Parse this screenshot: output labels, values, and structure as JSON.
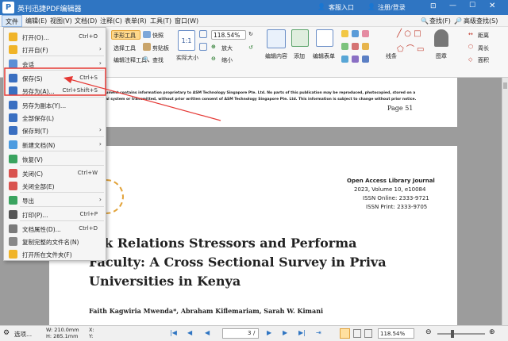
{
  "app": {
    "title": "英刊迅捷PDF编辑器",
    "logo": "P"
  },
  "titlebar": {
    "guest": "客服入口",
    "login": "注册/登录"
  },
  "menubar": {
    "items": [
      "文件",
      "编辑(E)",
      "视图(V)",
      "文档(D)",
      "注释(C)",
      "表单(R)",
      "工具(T)",
      "窗口(W)"
    ],
    "find": "查找(F)",
    "adv_find": "高级查找(S)"
  },
  "ribbon": {
    "hand_tool": "手形工具",
    "select_tool": "选择工具",
    "edit_annot_tool": "编辑注释工具",
    "snapshot": "快照",
    "clipboard": "剪贴板",
    "find": "查找",
    "actual_size": "实际大小",
    "zoom": "118.54%",
    "zoom_in": "放大",
    "zoom_out": "缩小",
    "edit_content": "编辑内容",
    "add": "添加",
    "edit_form": "编辑表单",
    "lines": "线条",
    "stamp": "图章",
    "distance": "距离",
    "perimeter": "周长",
    "area": "面积"
  },
  "document": {
    "page1_notice_1": "...ument contains information proprietary to ASM Technology Singapore Pte. Ltd. No parts of this publication may be reproduced, photocopied, stored on a",
    "page1_notice_2": "...al system or transmitted, without prior written consent of ASM Technology Singapore Pte. Ltd. This information is subject to change without prior notice.",
    "page1_num": "Page 51",
    "journal": "Open Access Library Journal",
    "volume": "2023, Volume 10, e10084",
    "issn_online": "ISSN Online: 2333-9721",
    "issn_print": "ISSN Print: 2333-9705",
    "title_1": "ork Relations Stressors and Performa",
    "title_2": "Faculty: A Cross Sectional Survey in Priva",
    "title_3": "Universities in Kenya",
    "authors": "Faith Kagwiria Mwenda*, Abraham Kiflemariam, Sarah W. Kimani"
  },
  "statusbar": {
    "options": "选项...",
    "width": "W: 210.0mm",
    "height": "H: 285.1mm",
    "x": "X:",
    "y": "Y:",
    "page": "3",
    "page_total": "/",
    "zoom": "118.54%"
  },
  "file_menu": {
    "items": [
      {
        "label": "打开(O)...",
        "shortcut": "Ctrl+O",
        "arrow": ""
      },
      {
        "label": "打开自(F)",
        "shortcut": "",
        "arrow": "›"
      },
      {
        "label": "会话",
        "shortcut": "",
        "arrow": "›"
      },
      {
        "label": "保存(S)",
        "shortcut": "Ctrl+S",
        "arrow": ""
      },
      {
        "label": "另存为(A)...",
        "shortcut": "Ctrl+Shift+S",
        "arrow": ""
      },
      {
        "label": "另存为副本(Y)...",
        "shortcut": "",
        "arrow": ""
      },
      {
        "label": "全部保存(L)",
        "shortcut": "",
        "arrow": ""
      },
      {
        "label": "保存到(T)",
        "shortcut": "",
        "arrow": "›"
      },
      {
        "label": "新建文档(N)",
        "shortcut": "",
        "arrow": "›"
      },
      {
        "label": "恢复(V)",
        "shortcut": "",
        "arrow": ""
      },
      {
        "label": "关闭(C)",
        "shortcut": "Ctrl+W",
        "arrow": ""
      },
      {
        "label": "关闭全部(E)",
        "shortcut": "",
        "arrow": ""
      },
      {
        "label": "导出",
        "shortcut": "",
        "arrow": "›"
      },
      {
        "label": "打印(P)...",
        "shortcut": "Ctrl+P",
        "arrow": ""
      },
      {
        "label": "文档属性(D)...",
        "shortcut": "Ctrl+D",
        "arrow": ""
      },
      {
        "label": "复制完整的文件名(N)",
        "shortcut": "",
        "arrow": ""
      },
      {
        "label": "打开所在文件夹(F)",
        "shortcut": "",
        "arrow": ""
      }
    ]
  },
  "colors": {
    "accent": "#2f75c2",
    "highlight_box": "#e53935",
    "arrow": "#e53935"
  }
}
